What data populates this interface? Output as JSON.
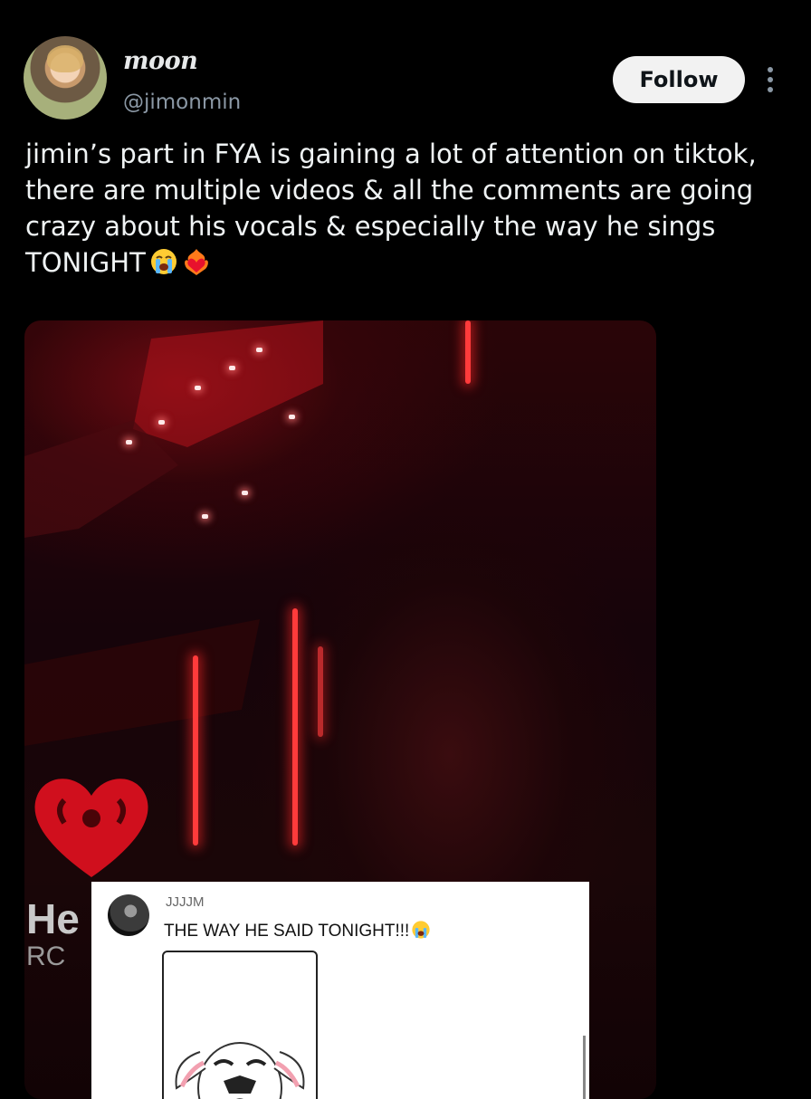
{
  "author": {
    "display_name": "moon",
    "handle": "@jimonmin"
  },
  "actions": {
    "follow_label": "Follow",
    "more_icon": "more-vertical-icon"
  },
  "tweet": {
    "text": "jimin’s part in FYA is gaining a lot of attention on tiktok, there are multiple videos & all the comments are going crazy about his vocals & especially the way he sings TONIGHT",
    "emojis": [
      "loudly-crying-face",
      "heart-on-fire"
    ]
  },
  "media": {
    "overlay_brand_line1": "He",
    "overlay_brand_line2": "RC",
    "comment": {
      "username": "JJJJM",
      "text": "THE WAY HE SAID TONIGHT!!!",
      "emoji": "loudly-crying-face"
    }
  },
  "colors": {
    "background": "#000000",
    "text": "#e7e9ea",
    "secondary_text": "#8b98a5",
    "follow_bg": "#f2f2f2",
    "stage_red": "#ff3b3b"
  }
}
